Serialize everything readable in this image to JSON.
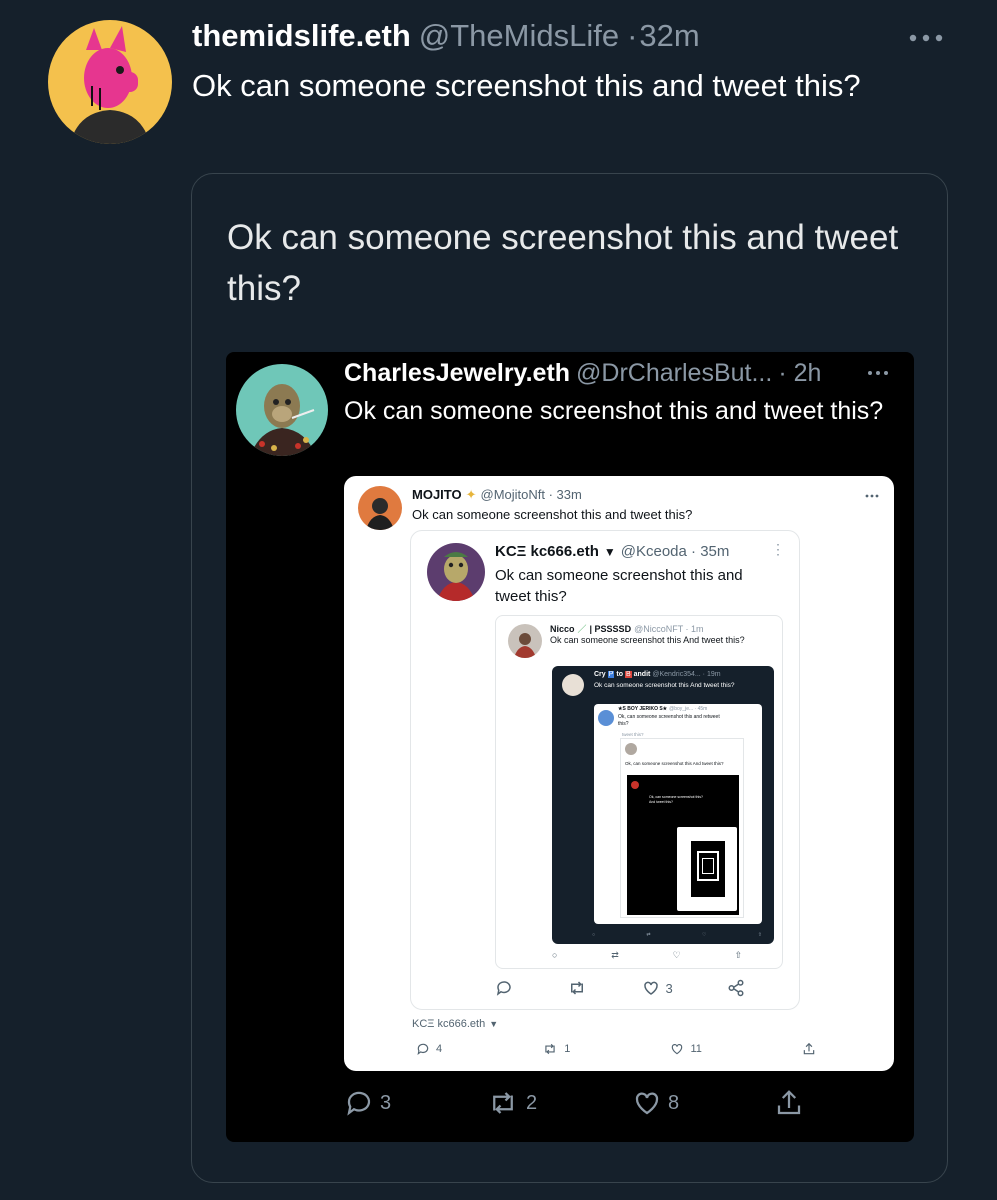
{
  "tweet": {
    "display_name": "themidslife.eth",
    "handle": "@TheMidsLife",
    "separator": "·",
    "time": "32m",
    "text": "Ok can someone screenshot this and tweet this?",
    "more_icon": "ellipsis-icon"
  },
  "quote": {
    "text": "Ok can someone screenshot this and tweet this?"
  },
  "shot1": {
    "display_name": "CharlesJewelry.eth",
    "handle": "@DrCharlesBut...",
    "time": "· 2h",
    "text": "Ok can someone screenshot this and tweet this?",
    "actions": {
      "reply": "3",
      "retweet": "2",
      "like": "8"
    }
  },
  "shot2": {
    "display_name": "MOJITO",
    "handle": "@MojitoNft · 33m",
    "text": "Ok can someone screenshot this and tweet this?",
    "footer_name": "KCΞ kc666.eth",
    "actions": {
      "reply": "4",
      "retweet": "1",
      "like": "11"
    }
  },
  "shot3": {
    "display_name": "KCΞ kc666.eth",
    "handle": "@Kceoda · 35m",
    "text": "Ok can someone screenshot this and tweet this?",
    "actions": {
      "like": "3"
    }
  },
  "shot4": {
    "display_name": "Nicco",
    "display_suffix": "| PSSSSD",
    "handle": "@NiccoNFT · 1m",
    "text": "Ok can someone screenshot this And tweet this?"
  },
  "shot5": {
    "display_name": "Cry",
    "display_mid": "to",
    "display_end": "andit",
    "handle": "@Kendric354... · 19m",
    "text": "Ok can someone screenshot this And tweet this?"
  },
  "shot6": {
    "display_name": "★S BOY JERIKO S★",
    "handle": "@boy_je... · 45m",
    "text": "Ok, can someone screenshot this and retweet this?",
    "sub_text": "tweet this?"
  },
  "shot7": {
    "text": "Ok, can someone screenshot this And tweet this?"
  },
  "shot8": {
    "text": "Ok, can someone screenshot this? And tweet this?"
  },
  "colors": {
    "background": "#15202b",
    "muted": "#8b98a5",
    "verified": "#1d9bf0",
    "avatar_bg": "#f4c14d"
  }
}
